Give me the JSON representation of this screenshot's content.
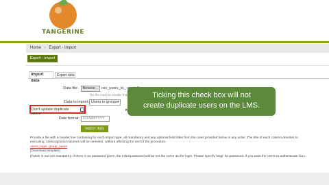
{
  "header": {
    "logo_text": "TANGERINE"
  },
  "breadcrumb": {
    "home": "Home",
    "separator": "›",
    "current": "Export - Import"
  },
  "page_title": "Export - Import",
  "tabs": [
    {
      "label": "Import data"
    },
    {
      "label": "Export data"
    }
  ],
  "form": {
    "file_label": "Data file:",
    "browse_label": "Browse...",
    "file_name": "csv_users_to_ ample2.csv",
    "file_hint": "The file must be smaller than 256",
    "data_to_import_label": "Data to import:",
    "data_to_import_value": "Users to groups",
    "duplicate_label": "Don't update duplicate users:",
    "date_format_label": "Date format:",
    "date_format_placeholder": "DD/MM/YYYY",
    "import_button": "Import data"
  },
  "callout": {
    "line1": "Ticking this check box will not",
    "line2": "create duplicate users on the LMS."
  },
  "info": {
    "line1": "Provide a file with a header line containing for each import type, all mandatory and any optional field titles from the ones provided below in any order. The title of each column denotes to",
    "line2": "executing. Unrecognized columns will be ommited, without affecting the rest of the procedure.",
    "link": "users_login, group_name",
    "download": "[Download template]",
    "fields": "(Fields in red are mandatory. If there is no password given, the initial password will be set the same as the login. Please specify 'Mqp' for password, if you want the users to authenticate via L"
  },
  "colors": {
    "brand_green": "#7b9a12",
    "callout_bg": "#5a8a3a",
    "highlight_red": "#e1251b",
    "logo_orange": "#e28a2b"
  }
}
